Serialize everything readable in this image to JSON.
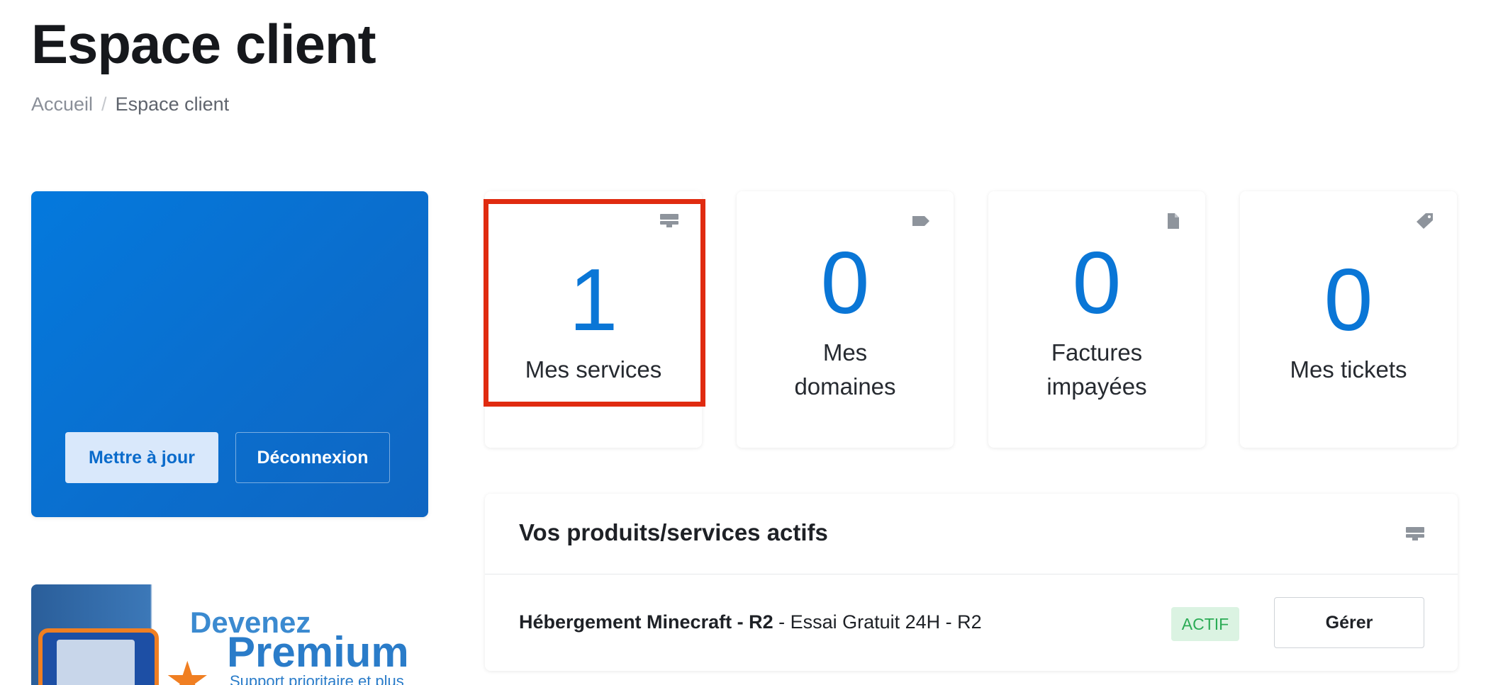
{
  "header": {
    "title": "Espace client",
    "breadcrumb": {
      "home": "Accueil",
      "separator": "/",
      "current": "Espace client"
    }
  },
  "profile": {
    "update_label": "Mettre à jour",
    "logout_label": "Déconnexion"
  },
  "promo": {
    "line1": "Devenez",
    "line2": "Premium",
    "line3": "Support prioritaire et plus"
  },
  "stats": [
    {
      "value": "1",
      "label": "Mes services",
      "icon": "server-icon"
    },
    {
      "value": "0",
      "label": "Mes domaines",
      "icon": "tag-icon"
    },
    {
      "value": "0",
      "label": "Factures impayées",
      "icon": "document-icon"
    },
    {
      "value": "0",
      "label": "Mes tickets",
      "icon": "ticket-icon"
    }
  ],
  "services": {
    "title": "Vos produits/services actifs",
    "icon": "server-icon",
    "items": [
      {
        "product": "Hébergement Minecraft - R2",
        "detail": " - Essai Gratuit 24H - R2",
        "status": "ACTIF",
        "action": "Gérer"
      }
    ]
  },
  "colors": {
    "accent": "#0a76d6",
    "highlight": "#e02b10",
    "status_active_bg": "#dbf3e2",
    "status_active_text": "#2bab55"
  }
}
